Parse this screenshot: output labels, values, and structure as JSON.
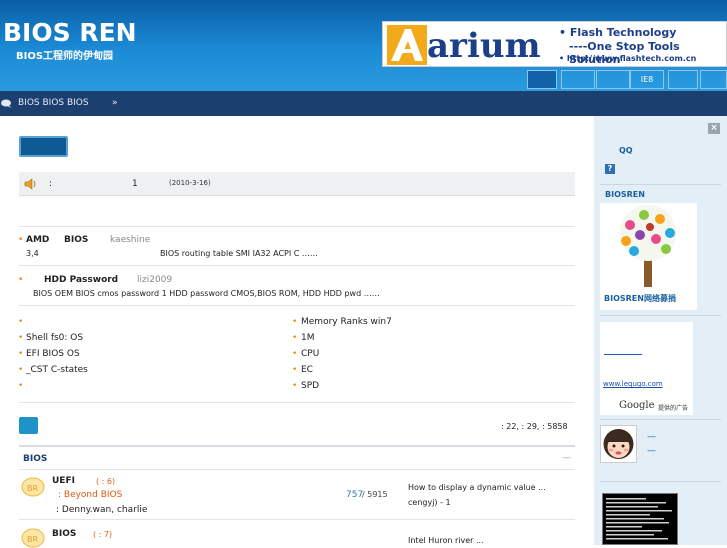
{
  "header": {
    "site_title": "BIOS REN",
    "site_subtitle": "BIOS工程师的伊甸园",
    "banner": {
      "brand": "arium",
      "line1": "• Flash Technology",
      "line2": "----One Stop Tools Solution",
      "line3": "• http://www.flashtech.com.cn"
    },
    "buttons": [
      "",
      "",
      "",
      "IE8",
      "",
      ""
    ]
  },
  "nav": {
    "breadcrumb": "BIOS  BIOS  BIOS",
    "arrow": "»"
  },
  "announcement": {
    "colon": ":",
    "num": "1",
    "date": "(2010-3-16)"
  },
  "hot_posts": [
    {
      "title_a": "AMD",
      "title_b": "BIOS",
      "author": "kaeshine",
      "desc_a": "3,4",
      "desc_b": "BIOS        routing table  SMI  IA32    ACPI      C      ……"
    },
    {
      "title_a": "HDD Password",
      "author": "lizi2009",
      "desc": "BIOS          OEM                  BIOS cmos password           1 HDD password        CMOS,BIOS ROM,  HDD        HDD pwd      ……"
    }
  ],
  "links_left": [
    "",
    "Shell   fs0:   OS",
    "EFI BIOS           OS",
    "  _CST      C-states",
    ""
  ],
  "links_right": [
    "Memory  Ranks win7",
    "  1M",
    "CPU",
    "EC",
    "         SPD"
  ],
  "stats": ": 22,  : 29,  : 5858",
  "section": {
    "title": "BIOS",
    "dash": "—"
  },
  "forums": [
    {
      "name": "UEFI",
      "count": "( : 6)",
      "sub": ": Beyond BIOS",
      "mods": ": Denny.wan, charlie",
      "topics": "757",
      "posts": "/ 5915",
      "last_title": "How to display a dynamic value ...",
      "last_by": "cengyj) - 1"
    },
    {
      "name": "BIOS",
      "count": "( : 7)",
      "last_title": "Intel Huron river        ..."
    }
  ],
  "rightcol": {
    "close": "×",
    "qq": "QQ",
    "help": "?",
    "biosren": "BIOSREN",
    "tree_caption": "BIOSREN网络募捐",
    "ad_url": "www.lequgo.com",
    "ad_google": "Google",
    "ad_google_cn": "提供的广告",
    "user_dash": "—"
  },
  "colors": {
    "header_top": "#0a5fa6",
    "nav": "#1b3f6e",
    "accent": "#f08c1e",
    "link": "#1b5fa0"
  }
}
